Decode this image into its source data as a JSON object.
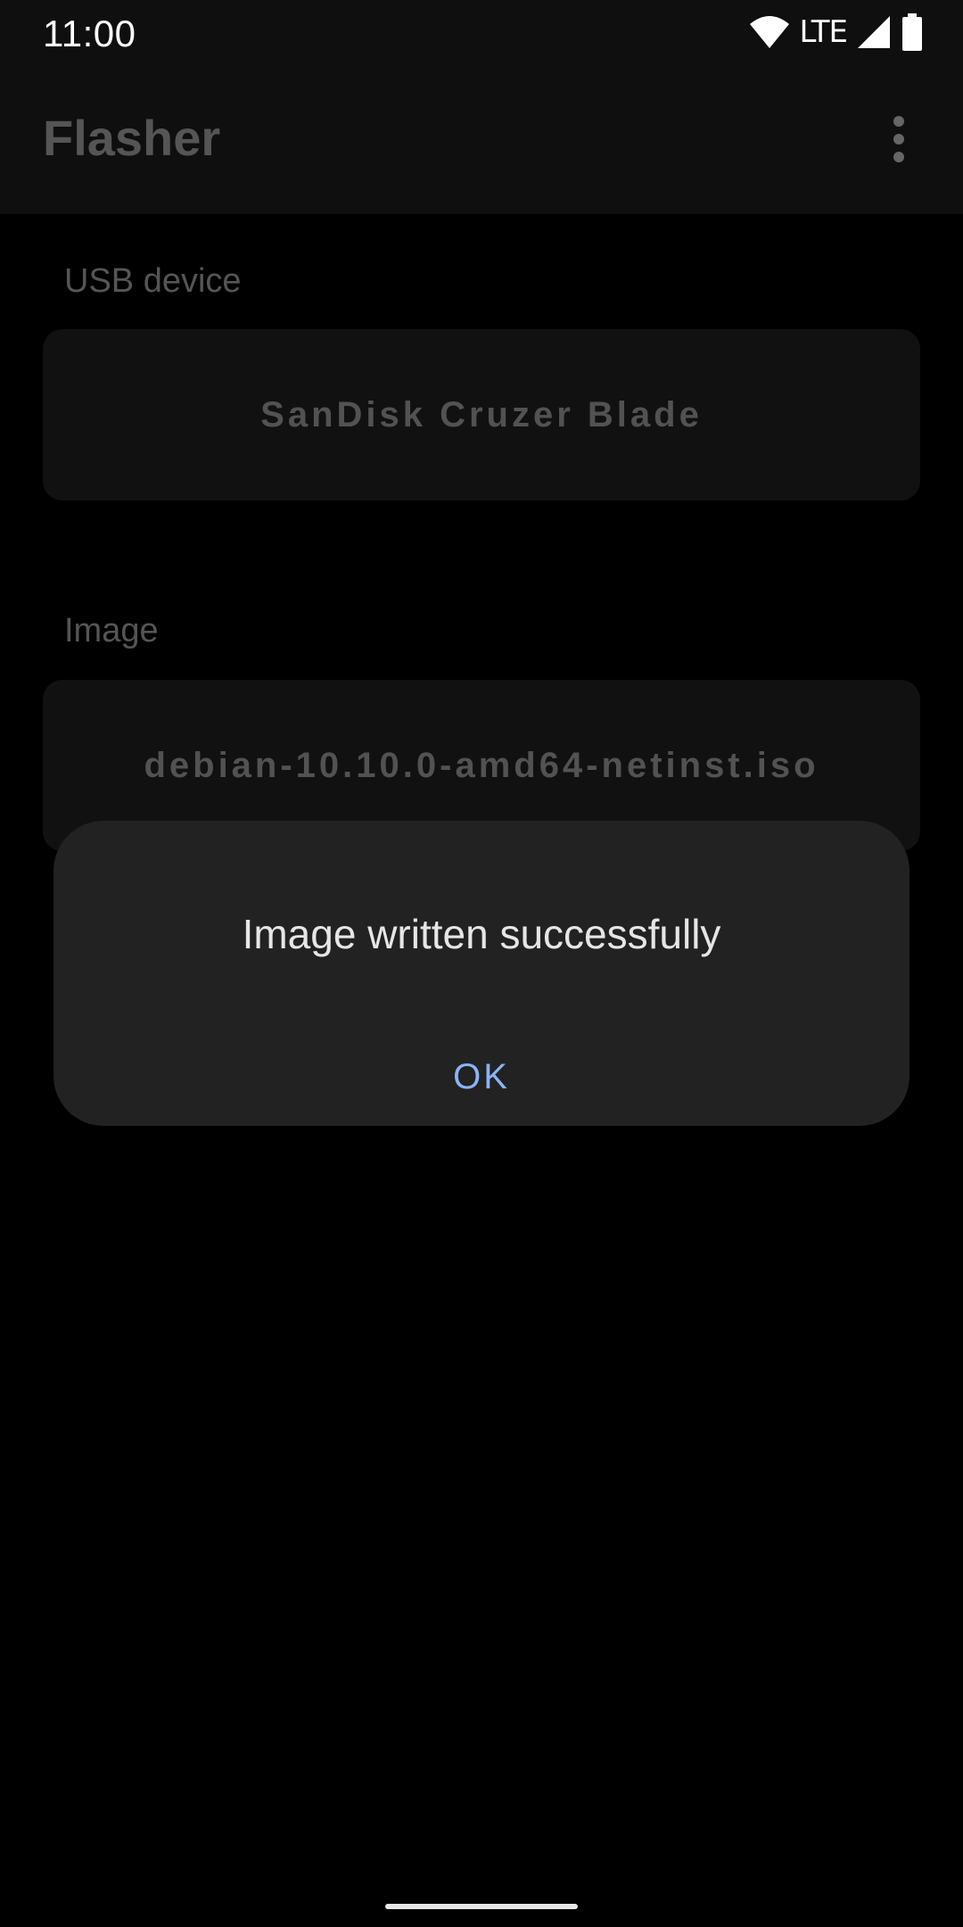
{
  "status_bar": {
    "time": "11:00",
    "network": "LTE",
    "icons": [
      "wifi-icon",
      "signal-icon",
      "battery-icon"
    ]
  },
  "app_bar": {
    "title": "Flasher",
    "menu_icon": "more-vert-icon"
  },
  "usb_section": {
    "label": "USB device",
    "value": "SanDisk Cruzer Blade"
  },
  "image_section": {
    "label": "Image",
    "value": "debian-10.10.0-amd64-netinst.iso"
  },
  "dialog": {
    "message": "Image written successfully",
    "ok_label": "OK"
  },
  "colors": {
    "accent": "#8ab4f8",
    "dialog_bg": "#222222",
    "background": "#000000"
  }
}
